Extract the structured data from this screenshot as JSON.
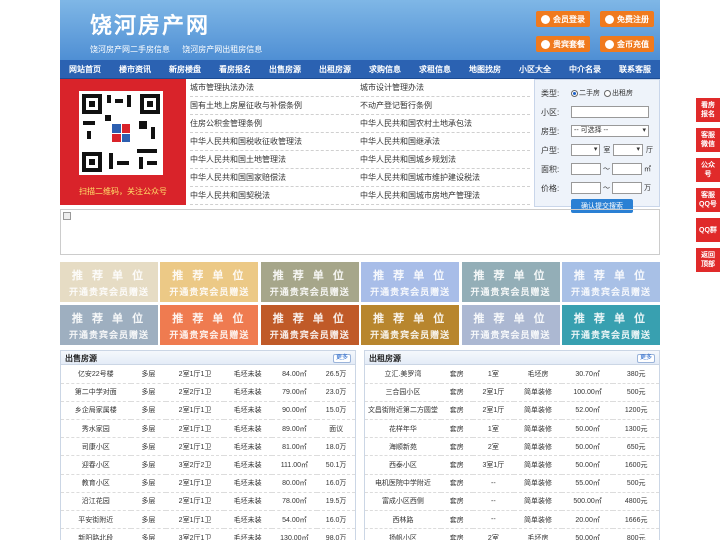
{
  "header": {
    "logo": "饶河房产网",
    "taglines": [
      "饶河房产网二手房信息",
      "饶河房产网出租房信息"
    ],
    "buttons": {
      "member_login": "会员登录",
      "free_register": "免费注册",
      "package": "贵宾套餐",
      "recharge": "金币充值"
    }
  },
  "nav": [
    "网站首页",
    "楼市资讯",
    "新房楼盘",
    "看房报名",
    "出售房源",
    "出租房源",
    "求购信息",
    "求租信息",
    "地图找房",
    "小区大全",
    "中介名录",
    "联系客服"
  ],
  "qr": {
    "caption": "扫描二维码，关注公众号"
  },
  "links": [
    [
      "城市管理执法办法",
      "城市设计管理办法"
    ],
    [
      "国有土地上房屋征收与补偿条例",
      "不动产登记暂行条例"
    ],
    [
      "住房公积金管理条例",
      "中华人民共和国农村土地承包法"
    ],
    [
      "中华人民共和国税收征收管理法",
      "中华人民共和国继承法"
    ],
    [
      "中华人民共和国土地管理法",
      "中华人民共和国城乡规划法"
    ],
    [
      "中华人民共和国国家赔偿法",
      "中华人民共和国城市维护建设税法"
    ],
    [
      "中华人民共和国契税法",
      "中华人民共和国城市房地产管理法"
    ]
  ],
  "search": {
    "type_label": "类型:",
    "opt_second": "二手房",
    "opt_rent": "出租房",
    "area_label": "小区:",
    "house_label": "房型:",
    "house_placeholder": "-- 可选择 --",
    "layout_label": "户型:",
    "room_unit": "室",
    "hall_unit": "厅",
    "size_label": "面积:",
    "size_unit": "㎡",
    "price_label": "价格:",
    "price_unit": "万",
    "tilde": "～",
    "submit": "确认提交搜索"
  },
  "promo": {
    "title": "推 荐 单 位",
    "sub": "开通贵宾会员赠送",
    "colors": [
      "#e6dcc4",
      "#ecc986",
      "#a6a68a",
      "#a8bde8",
      "#93aeb7",
      "#a8c0e6",
      "#9eafc0",
      "#ef7b50",
      "#c05a28",
      "#b8862e",
      "#acb8d2",
      "#38a0b0"
    ]
  },
  "sale": {
    "title": "出售房源",
    "more": "更多",
    "rows": [
      [
        "亿安22号楼",
        "多层",
        "2室1厅1卫",
        "毛坯未装",
        "84.00㎡",
        "26.5万"
      ],
      [
        "第二中学对面",
        "多层",
        "2室2厅1卫",
        "毛坯未装",
        "79.00㎡",
        "23.0万"
      ],
      [
        "乡企局家属楼",
        "多层",
        "2室1厅1卫",
        "毛坯未装",
        "90.00㎡",
        "15.0万"
      ],
      [
        "秀水家园",
        "多层",
        "2室1厅1卫",
        "毛坯未装",
        "89.00㎡",
        "面议"
      ],
      [
        "司康小区",
        "多层",
        "2室1厅1卫",
        "毛坯未装",
        "81.00㎡",
        "18.0万"
      ],
      [
        "迎春小区",
        "多层",
        "3室2厅2卫",
        "毛坯未装",
        "111.00㎡",
        "50.1万"
      ],
      [
        "教育小区",
        "多层",
        "2室1厅1卫",
        "毛坯未装",
        "80.00㎡",
        "16.0万"
      ],
      [
        "沿江花园",
        "多层",
        "2室1厅1卫",
        "毛坯未装",
        "78.00㎡",
        "19.5万"
      ],
      [
        "平安街附近",
        "多层",
        "2室1厅1卫",
        "毛坯未装",
        "54.00㎡",
        "16.0万"
      ],
      [
        "新阳路北段",
        "多层",
        "3室2厅1卫",
        "毛坯未装",
        "130.00㎡",
        "98.0万"
      ]
    ]
  },
  "rent": {
    "title": "出租房源",
    "more": "更多",
    "rows": [
      [
        "立汇.美罗湾",
        "套房",
        "1室",
        "毛坯房",
        "30.70㎡",
        "380元"
      ],
      [
        "三合园小区",
        "套房",
        "2室1厅",
        "简单装修",
        "100.00㎡",
        "500元"
      ],
      [
        "文昌街附近第二方圆堂",
        "套房",
        "2室1厅",
        "简单装修",
        "52.00㎡",
        "1200元"
      ],
      [
        "花样年华",
        "套房",
        "1室",
        "简单装修",
        "50.00㎡",
        "1300元"
      ],
      [
        "海顺新苑",
        "套房",
        "2室",
        "简单装修",
        "50.00㎡",
        "650元"
      ],
      [
        "西泰小区",
        "套房",
        "3室1厅",
        "简单装修",
        "50.00㎡",
        "1600元"
      ],
      [
        "电机医院中学附近",
        "套房",
        "--",
        "简单装修",
        "55.00㎡",
        "500元"
      ],
      [
        "富成小区西侧",
        "套房",
        "--",
        "简单装修",
        "500.00㎡",
        "4800元"
      ],
      [
        "西林路",
        "套房",
        "--",
        "简单装修",
        "20.00㎡",
        "1666元"
      ],
      [
        "扬帆小区",
        "套房",
        "2室",
        "毛坯房",
        "50.00㎡",
        "800元"
      ]
    ]
  },
  "side": [
    "看房报名",
    "客服微信",
    "公众号",
    "客服QQ号",
    "QQ群",
    "返回顶部"
  ]
}
